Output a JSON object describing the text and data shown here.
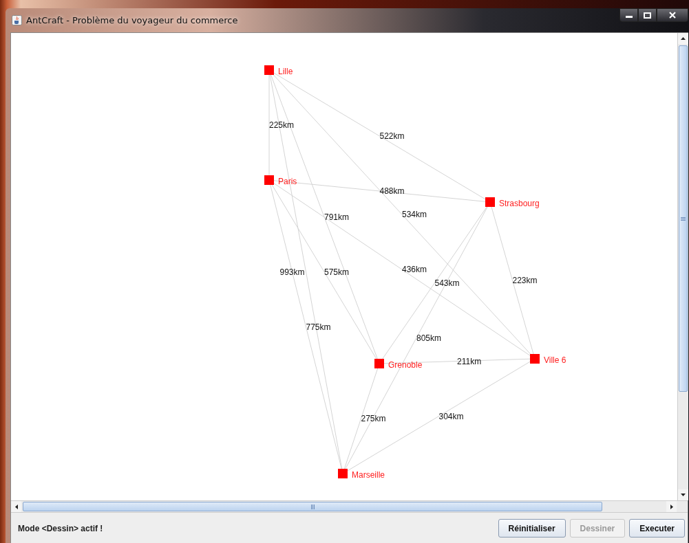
{
  "window": {
    "title": "AntCraft - Problème du voyageur du commerce"
  },
  "graph": {
    "nodes": [
      {
        "name": "Lille"
      },
      {
        "name": "Paris"
      },
      {
        "name": "Strasbourg"
      },
      {
        "name": "Grenoble"
      },
      {
        "name": "Ville 6"
      },
      {
        "name": "Marseille"
      }
    ],
    "edges": [
      {
        "label": "225km"
      },
      {
        "label": "522km"
      },
      {
        "label": "791km"
      },
      {
        "label": "534km"
      },
      {
        "label": "993km"
      },
      {
        "label": "488km"
      },
      {
        "label": "575km"
      },
      {
        "label": "436km"
      },
      {
        "label": "775km"
      },
      {
        "label": "543km"
      },
      {
        "label": "223km"
      },
      {
        "label": "805km"
      },
      {
        "label": "211km"
      },
      {
        "label": "275km"
      },
      {
        "label": "304km"
      }
    ]
  },
  "status_bar": {
    "text": "Mode <Dessin> actif !"
  },
  "buttons": [
    {
      "label": "Réinitialiser",
      "disabled": false
    },
    {
      "label": "Dessiner",
      "disabled": true
    },
    {
      "label": "Executer",
      "disabled": false
    }
  ]
}
